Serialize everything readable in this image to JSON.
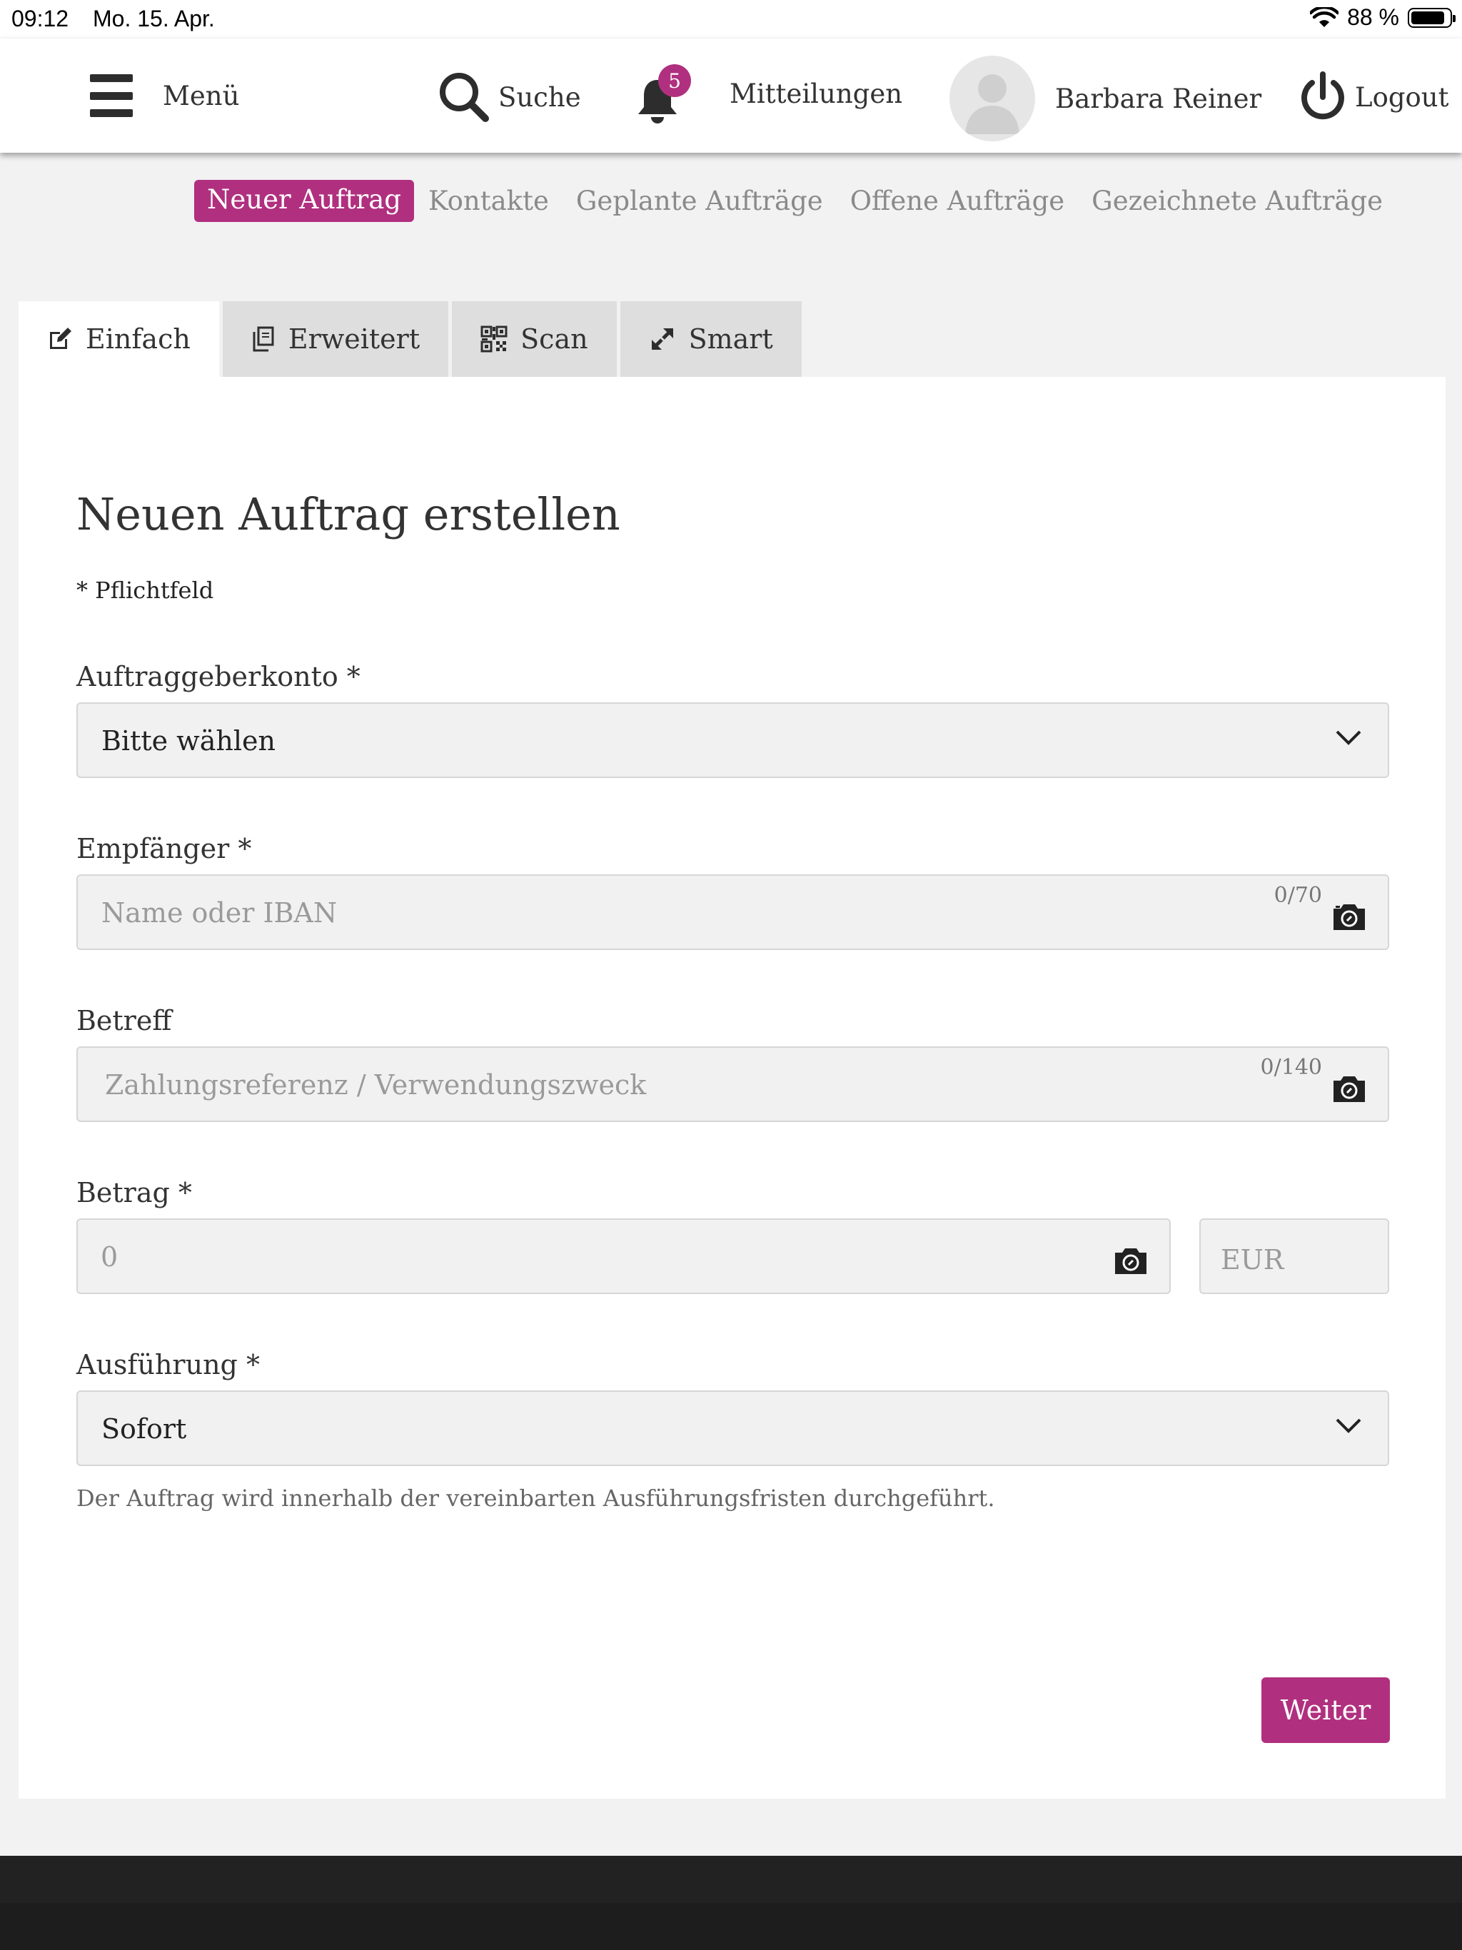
{
  "status_bar": {
    "time": "09:12",
    "date": "Mo. 15. Apr.",
    "battery": "88 %",
    "battery_level": 0.88
  },
  "header": {
    "menu_label": "Menü",
    "search_label": "Suche",
    "notification_count": "5",
    "notifications_label": "Mitteilungen",
    "user_name": "Barbara Reiner",
    "logout_label": "Logout"
  },
  "subnav": {
    "active": "Neuer Auftrag",
    "items": [
      "Kontakte",
      "Geplante Aufträge",
      "Offene Aufträge",
      "Gezeichnete Aufträge"
    ]
  },
  "tabs": [
    {
      "label": "Einfach",
      "icon": "edit-icon",
      "active": true
    },
    {
      "label": "Erweitert",
      "icon": "copy-icon",
      "active": false
    },
    {
      "label": "Scan",
      "icon": "qr-code-icon",
      "active": false
    },
    {
      "label": "Smart",
      "icon": "smart-arrows-icon",
      "active": false
    }
  ],
  "form": {
    "title": "Neuen Auftrag erstellen",
    "required_note": "* Pflichtfeld",
    "account": {
      "label": "Auftraggeberkonto *",
      "value": "Bitte wählen"
    },
    "recipient": {
      "label": "Empfänger *",
      "placeholder": "Name oder IBAN",
      "counter": "0/70"
    },
    "subject": {
      "label": "Betreff",
      "placeholder": "Zahlungsreferenz / Verwendungszweck",
      "counter": "0/140"
    },
    "amount": {
      "label": "Betrag *",
      "placeholder": "0",
      "currency_placeholder": "EUR"
    },
    "execution": {
      "label": "Ausführung *",
      "value": "Sofort",
      "hint": "Der Auftrag wird innerhalb der vereinbarten Ausführungsfristen durchgeführt."
    },
    "submit_label": "Weiter"
  },
  "colors": {
    "accent": "#b0307f",
    "footer": "#222222",
    "background": "#f2f2f2"
  }
}
